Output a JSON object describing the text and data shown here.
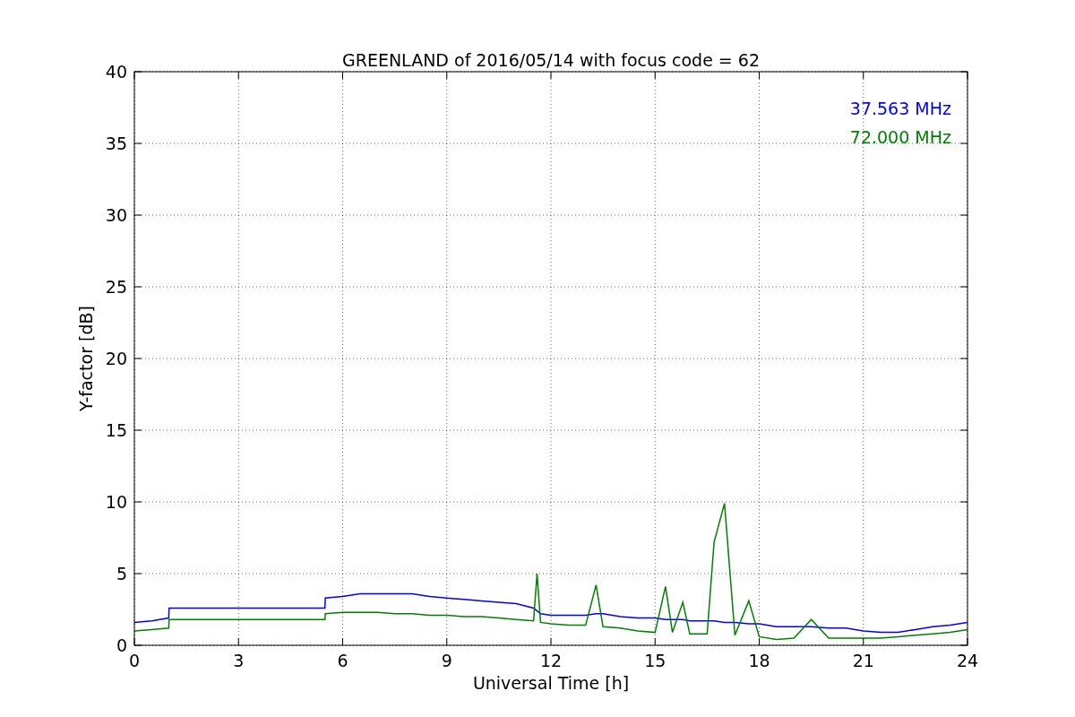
{
  "figure": {
    "chart_data": {
      "type": "line",
      "title": "GREENLAND of 2016/05/14 with focus code = 62",
      "xlabel": "Universal Time [h]",
      "ylabel": "Y-factor [dB]",
      "x": [
        0,
        0.5,
        0.99,
        1.0,
        2,
        3,
        4,
        5,
        5.49,
        5.5,
        6,
        6.5,
        7,
        7.5,
        8,
        8.5,
        9,
        9.5,
        10,
        10.5,
        11,
        11.5,
        11.6,
        11.7,
        12,
        12.5,
        13,
        13.3,
        13.5,
        14,
        14.5,
        15,
        15.3,
        15.5,
        15.8,
        16,
        16.5,
        16.7,
        17,
        17.3,
        17.7,
        18,
        18.5,
        19,
        19.5,
        20,
        20.5,
        21,
        21.5,
        22,
        22.5,
        23,
        23.5,
        24
      ],
      "series": [
        {
          "name": "37.563 MHz",
          "color": "#0000ff",
          "values": [
            1.6,
            1.7,
            1.9,
            2.6,
            2.6,
            2.6,
            2.6,
            2.6,
            2.6,
            3.3,
            3.4,
            3.6,
            3.6,
            3.6,
            3.6,
            3.4,
            3.3,
            3.2,
            3.1,
            3.0,
            2.9,
            2.6,
            2.4,
            2.2,
            2.1,
            2.1,
            2.1,
            2.2,
            2.2,
            2.0,
            1.9,
            1.9,
            1.8,
            1.8,
            1.8,
            1.7,
            1.7,
            1.7,
            1.6,
            1.6,
            1.5,
            1.5,
            1.3,
            1.3,
            1.3,
            1.2,
            1.2,
            1.0,
            0.9,
            0.9,
            1.1,
            1.3,
            1.4,
            1.6
          ]
        },
        {
          "name": "72.000 MHz",
          "color": "#008000",
          "values": [
            1.0,
            1.1,
            1.2,
            1.8,
            1.8,
            1.8,
            1.8,
            1.8,
            1.8,
            2.2,
            2.3,
            2.3,
            2.3,
            2.2,
            2.2,
            2.1,
            2.1,
            2.0,
            2.0,
            1.9,
            1.8,
            1.7,
            5.0,
            1.6,
            1.5,
            1.4,
            1.4,
            4.2,
            1.3,
            1.2,
            1.0,
            0.9,
            4.1,
            0.9,
            3.0,
            0.8,
            0.8,
            7.2,
            9.9,
            0.7,
            3.1,
            0.6,
            0.4,
            0.5,
            1.8,
            0.5,
            0.5,
            0.5,
            0.5,
            0.6,
            0.7,
            0.8,
            0.9,
            1.1
          ]
        }
      ],
      "grid": true,
      "xlim": [
        0,
        24
      ],
      "ylim": [
        0,
        40
      ],
      "xticks": [
        0,
        3,
        6,
        9,
        12,
        15,
        18,
        21,
        24
      ],
      "yticks": [
        0,
        5,
        10,
        15,
        20,
        25,
        30,
        35,
        40
      ]
    }
  }
}
